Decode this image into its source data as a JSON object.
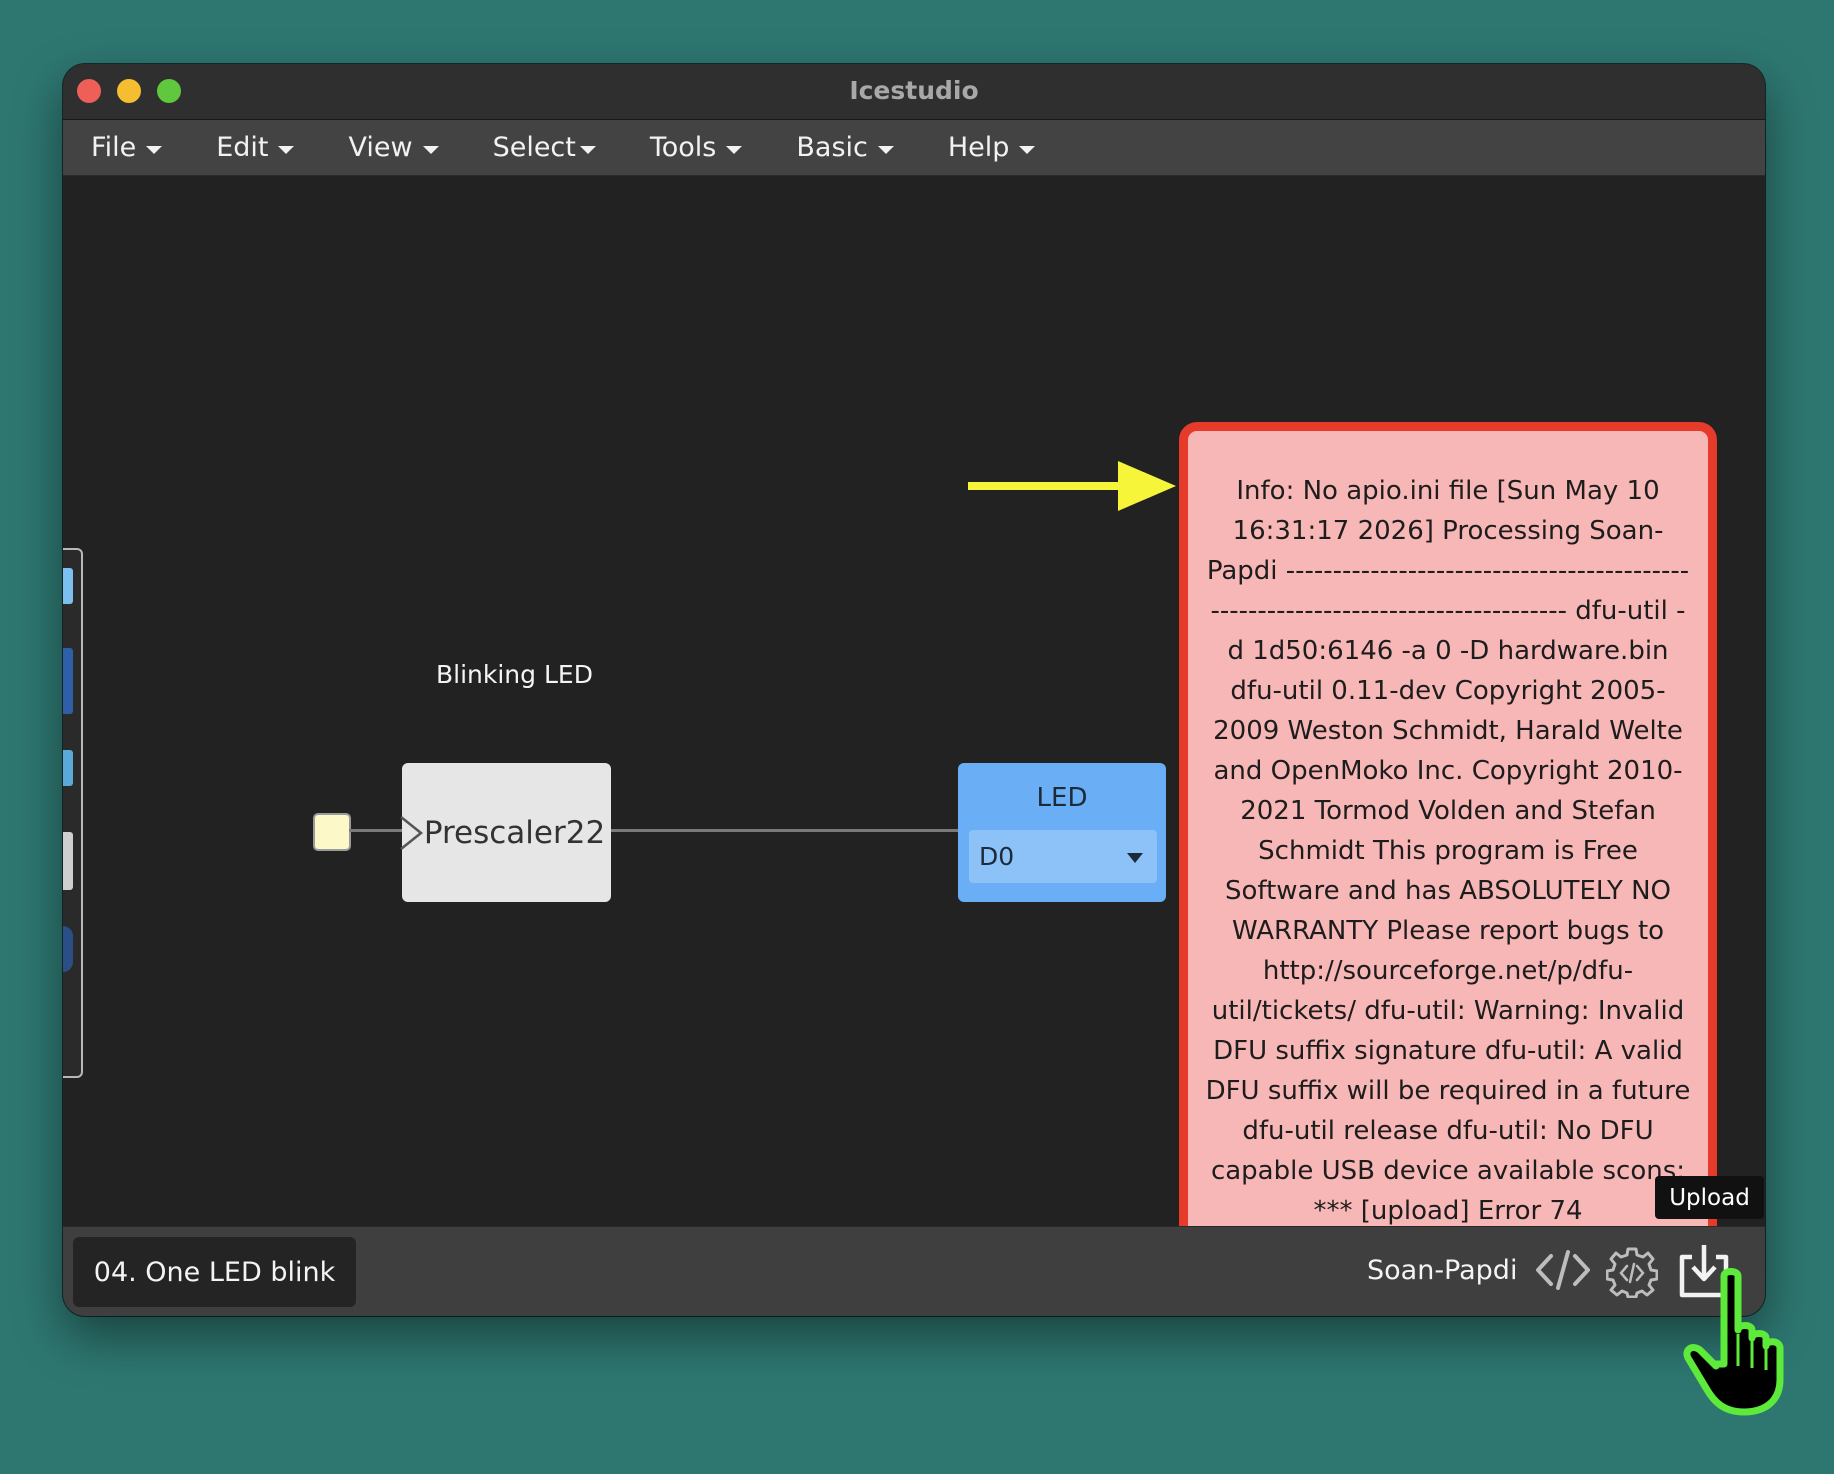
{
  "window": {
    "title": "Icestudio"
  },
  "menu": {
    "file": "File",
    "edit": "Edit",
    "view": "View",
    "select": "Select",
    "tools": "Tools",
    "basic": "Basic",
    "help": "Help"
  },
  "canvas": {
    "block_label": "Blinking LED",
    "prescaler": {
      "name": "Prescaler22"
    },
    "led": {
      "title": "LED",
      "pin_value": "D0"
    }
  },
  "error_panel": {
    "message": "Info: No apio.ini file [Sun May 10 16:31:17 2026] Processing Soan-Papdi --------------------------------------------------------------------------------- dfu-util -d 1d50:6146 -a 0 -D hardware.bin dfu-util 0.11-dev Copyright 2005-2009 Weston Schmidt, Harald Welte and OpenMoko Inc. Copyright 2010-2021 Tormod Volden and Stefan Schmidt This program is Free Software and has ABSOLUTELY NO WARRANTY Please report bugs to http://sourceforge.net/p/dfu-util/tickets/ dfu-util: Warning: Invalid DFU suffix signature dfu-util: A valid DFU suffix will be required in a future dfu-util release dfu-util: No DFU capable USB device available scons: *** [upload] Error 74"
  },
  "bottombar": {
    "project_name": "04. One LED blink",
    "board_name": "Soan-Papdi",
    "upload_tooltip": "Upload"
  },
  "icons": {
    "code": "code-icon",
    "verify": "gear-icon",
    "upload": "upload-icon",
    "cursor": "pointer-hand-icon",
    "arrow": "arrow-right-icon"
  },
  "colors": {
    "background": "#2e7771",
    "error_border": "#e63b2a",
    "error_fill": "#f7b7b6",
    "led_block": "#6aaff5",
    "arrow": "#f7f53a",
    "cursor_outline": "#5dea3a"
  }
}
